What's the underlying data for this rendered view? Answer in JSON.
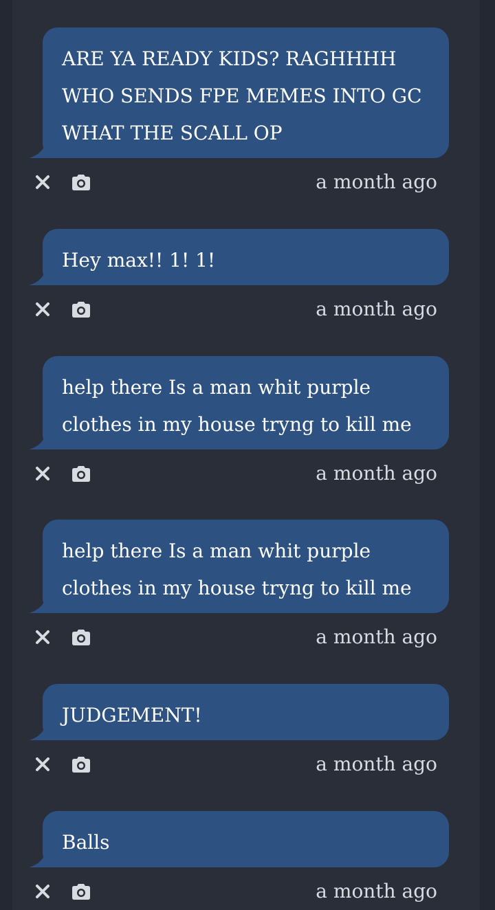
{
  "messages": [
    {
      "text": "ARE YA READY KIDS? RAGHHHH\nWHO SENDS FPE MEMES INTO GC\nWHAT THE SCALL OP",
      "time": "a month ago"
    },
    {
      "text": "Hey max!! 1! 1!",
      "time": "a month ago"
    },
    {
      "text": "help there Is a man whit purple\nclothes in my house tryng to kill me",
      "time": "a month ago"
    },
    {
      "text": "help there Is a man whit purple\nclothes in my house tryng to kill me",
      "time": "a month ago"
    },
    {
      "text": "JUDGEMENT!",
      "time": "a month ago"
    },
    {
      "text": "Balls",
      "time": "a month ago"
    }
  ],
  "icons": {
    "delete": "close-icon",
    "screenshot": "camera-icon"
  },
  "colors": {
    "bubble": "#2d5282",
    "background": "#2a2e39",
    "text": "#ffffff",
    "timestamp": "#d8dbe0"
  }
}
